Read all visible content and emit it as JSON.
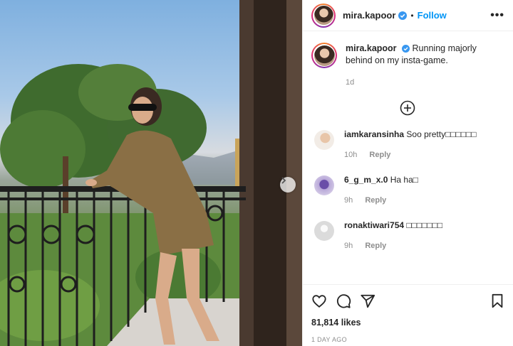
{
  "post": {
    "username": "mira.kapoor",
    "follow_label": "Follow",
    "more_label": "•••",
    "separator": "•"
  },
  "caption": {
    "username": "mira.kapoor",
    "text": "Running majorly behind on my insta-game.",
    "time": "1d"
  },
  "comments": [
    {
      "user": "iamkaransinha",
      "text": "Soo pretty□□□□□□",
      "time": "10h",
      "reply": "Reply"
    },
    {
      "user": "6_g_m_x.0",
      "text": "Ha ha□",
      "time": "9h",
      "reply": "Reply"
    },
    {
      "user": "ronaktiwari754",
      "text": "□□□□□□□",
      "time": "9h",
      "reply": "Reply"
    }
  ],
  "footer": {
    "likes": "81,814 likes",
    "posted": "1 DAY AGO"
  },
  "icons": {
    "verified": "verified-badge-icon",
    "add_comment": "add-circle-icon",
    "like": "heart-icon",
    "comment": "comment-bubble-icon",
    "share": "paper-plane-icon",
    "save": "bookmark-icon",
    "next": "chevron-right-icon"
  },
  "colors": {
    "accent": "#0095f6",
    "verified": "#3897f0",
    "muted": "#8e8e8e"
  }
}
